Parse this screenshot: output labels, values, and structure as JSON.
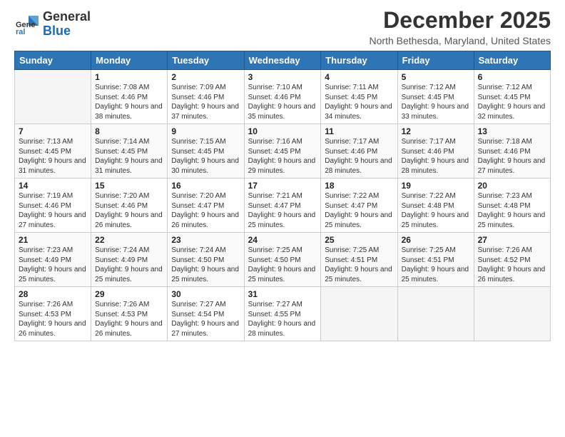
{
  "header": {
    "logo_general": "General",
    "logo_blue": "Blue",
    "month_title": "December 2025",
    "location": "North Bethesda, Maryland, United States"
  },
  "days_of_week": [
    "Sunday",
    "Monday",
    "Tuesday",
    "Wednesday",
    "Thursday",
    "Friday",
    "Saturday"
  ],
  "weeks": [
    [
      {
        "day": "",
        "empty": true
      },
      {
        "day": "1",
        "sunrise": "Sunrise: 7:08 AM",
        "sunset": "Sunset: 4:46 PM",
        "daylight": "Daylight: 9 hours and 38 minutes."
      },
      {
        "day": "2",
        "sunrise": "Sunrise: 7:09 AM",
        "sunset": "Sunset: 4:46 PM",
        "daylight": "Daylight: 9 hours and 37 minutes."
      },
      {
        "day": "3",
        "sunrise": "Sunrise: 7:10 AM",
        "sunset": "Sunset: 4:46 PM",
        "daylight": "Daylight: 9 hours and 35 minutes."
      },
      {
        "day": "4",
        "sunrise": "Sunrise: 7:11 AM",
        "sunset": "Sunset: 4:45 PM",
        "daylight": "Daylight: 9 hours and 34 minutes."
      },
      {
        "day": "5",
        "sunrise": "Sunrise: 7:12 AM",
        "sunset": "Sunset: 4:45 PM",
        "daylight": "Daylight: 9 hours and 33 minutes."
      },
      {
        "day": "6",
        "sunrise": "Sunrise: 7:12 AM",
        "sunset": "Sunset: 4:45 PM",
        "daylight": "Daylight: 9 hours and 32 minutes."
      }
    ],
    [
      {
        "day": "7",
        "sunrise": "Sunrise: 7:13 AM",
        "sunset": "Sunset: 4:45 PM",
        "daylight": "Daylight: 9 hours and 31 minutes."
      },
      {
        "day": "8",
        "sunrise": "Sunrise: 7:14 AM",
        "sunset": "Sunset: 4:45 PM",
        "daylight": "Daylight: 9 hours and 31 minutes."
      },
      {
        "day": "9",
        "sunrise": "Sunrise: 7:15 AM",
        "sunset": "Sunset: 4:45 PM",
        "daylight": "Daylight: 9 hours and 30 minutes."
      },
      {
        "day": "10",
        "sunrise": "Sunrise: 7:16 AM",
        "sunset": "Sunset: 4:45 PM",
        "daylight": "Daylight: 9 hours and 29 minutes."
      },
      {
        "day": "11",
        "sunrise": "Sunrise: 7:17 AM",
        "sunset": "Sunset: 4:46 PM",
        "daylight": "Daylight: 9 hours and 28 minutes."
      },
      {
        "day": "12",
        "sunrise": "Sunrise: 7:17 AM",
        "sunset": "Sunset: 4:46 PM",
        "daylight": "Daylight: 9 hours and 28 minutes."
      },
      {
        "day": "13",
        "sunrise": "Sunrise: 7:18 AM",
        "sunset": "Sunset: 4:46 PM",
        "daylight": "Daylight: 9 hours and 27 minutes."
      }
    ],
    [
      {
        "day": "14",
        "sunrise": "Sunrise: 7:19 AM",
        "sunset": "Sunset: 4:46 PM",
        "daylight": "Daylight: 9 hours and 27 minutes."
      },
      {
        "day": "15",
        "sunrise": "Sunrise: 7:20 AM",
        "sunset": "Sunset: 4:46 PM",
        "daylight": "Daylight: 9 hours and 26 minutes."
      },
      {
        "day": "16",
        "sunrise": "Sunrise: 7:20 AM",
        "sunset": "Sunset: 4:47 PM",
        "daylight": "Daylight: 9 hours and 26 minutes."
      },
      {
        "day": "17",
        "sunrise": "Sunrise: 7:21 AM",
        "sunset": "Sunset: 4:47 PM",
        "daylight": "Daylight: 9 hours and 25 minutes."
      },
      {
        "day": "18",
        "sunrise": "Sunrise: 7:22 AM",
        "sunset": "Sunset: 4:47 PM",
        "daylight": "Daylight: 9 hours and 25 minutes."
      },
      {
        "day": "19",
        "sunrise": "Sunrise: 7:22 AM",
        "sunset": "Sunset: 4:48 PM",
        "daylight": "Daylight: 9 hours and 25 minutes."
      },
      {
        "day": "20",
        "sunrise": "Sunrise: 7:23 AM",
        "sunset": "Sunset: 4:48 PM",
        "daylight": "Daylight: 9 hours and 25 minutes."
      }
    ],
    [
      {
        "day": "21",
        "sunrise": "Sunrise: 7:23 AM",
        "sunset": "Sunset: 4:49 PM",
        "daylight": "Daylight: 9 hours and 25 minutes."
      },
      {
        "day": "22",
        "sunrise": "Sunrise: 7:24 AM",
        "sunset": "Sunset: 4:49 PM",
        "daylight": "Daylight: 9 hours and 25 minutes."
      },
      {
        "day": "23",
        "sunrise": "Sunrise: 7:24 AM",
        "sunset": "Sunset: 4:50 PM",
        "daylight": "Daylight: 9 hours and 25 minutes."
      },
      {
        "day": "24",
        "sunrise": "Sunrise: 7:25 AM",
        "sunset": "Sunset: 4:50 PM",
        "daylight": "Daylight: 9 hours and 25 minutes."
      },
      {
        "day": "25",
        "sunrise": "Sunrise: 7:25 AM",
        "sunset": "Sunset: 4:51 PM",
        "daylight": "Daylight: 9 hours and 25 minutes."
      },
      {
        "day": "26",
        "sunrise": "Sunrise: 7:25 AM",
        "sunset": "Sunset: 4:51 PM",
        "daylight": "Daylight: 9 hours and 25 minutes."
      },
      {
        "day": "27",
        "sunrise": "Sunrise: 7:26 AM",
        "sunset": "Sunset: 4:52 PM",
        "daylight": "Daylight: 9 hours and 26 minutes."
      }
    ],
    [
      {
        "day": "28",
        "sunrise": "Sunrise: 7:26 AM",
        "sunset": "Sunset: 4:53 PM",
        "daylight": "Daylight: 9 hours and 26 minutes."
      },
      {
        "day": "29",
        "sunrise": "Sunrise: 7:26 AM",
        "sunset": "Sunset: 4:53 PM",
        "daylight": "Daylight: 9 hours and 26 minutes."
      },
      {
        "day": "30",
        "sunrise": "Sunrise: 7:27 AM",
        "sunset": "Sunset: 4:54 PM",
        "daylight": "Daylight: 9 hours and 27 minutes."
      },
      {
        "day": "31",
        "sunrise": "Sunrise: 7:27 AM",
        "sunset": "Sunset: 4:55 PM",
        "daylight": "Daylight: 9 hours and 28 minutes."
      },
      {
        "day": "",
        "empty": true
      },
      {
        "day": "",
        "empty": true
      },
      {
        "day": "",
        "empty": true
      }
    ]
  ]
}
